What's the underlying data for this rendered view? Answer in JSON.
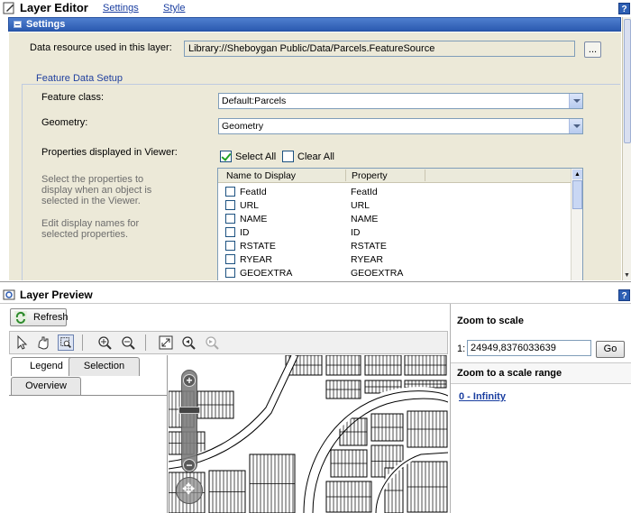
{
  "editor": {
    "title": "Layer Editor",
    "nav": [
      "Settings",
      "Style"
    ],
    "help": "?"
  },
  "settings": {
    "header": "Settings",
    "resource_label": "Data resource used in this layer:",
    "resource_value": "Library://Sheboygan Public/Data/Parcels.FeatureSource",
    "browse_label": "...",
    "group_legend": "Feature Data Setup",
    "feature_class_label": "Feature class:",
    "feature_class_value": "Default:Parcels",
    "geometry_label": "Geometry:",
    "geometry_value": "Geometry",
    "properties_label": "Properties displayed in Viewer:",
    "select_all": "Select All",
    "clear_all": "Clear All",
    "hint1": "Select the properties to display when an object is selected in the Viewer.",
    "hint2": "Edit display names for selected properties.",
    "table_headers": [
      "Name to Display",
      "Property"
    ],
    "rows": [
      {
        "name": "FeatId",
        "property": "FeatId"
      },
      {
        "name": "URL",
        "property": "URL"
      },
      {
        "name": "NAME",
        "property": "NAME"
      },
      {
        "name": "ID",
        "property": "ID"
      },
      {
        "name": "RSTATE",
        "property": "RSTATE"
      },
      {
        "name": "RYEAR",
        "property": "RYEAR"
      },
      {
        "name": "GEOEXTRA",
        "property": "GEOEXTRA"
      }
    ]
  },
  "preview": {
    "title": "Layer Preview",
    "help": "?",
    "refresh": "Refresh",
    "tabs": [
      "Legend",
      "Selection",
      "Overview"
    ],
    "zoom_to_scale": "Zoom to scale",
    "scale_prefix": "1:",
    "scale_value": "24949,8376033639",
    "go": "Go",
    "zoom_range": "Zoom to a scale range",
    "range_link": "0 - Infinity"
  },
  "colors": {
    "accent": "#2b5ab0",
    "link": "#1a3ea0",
    "panel": "#ece9d8"
  }
}
